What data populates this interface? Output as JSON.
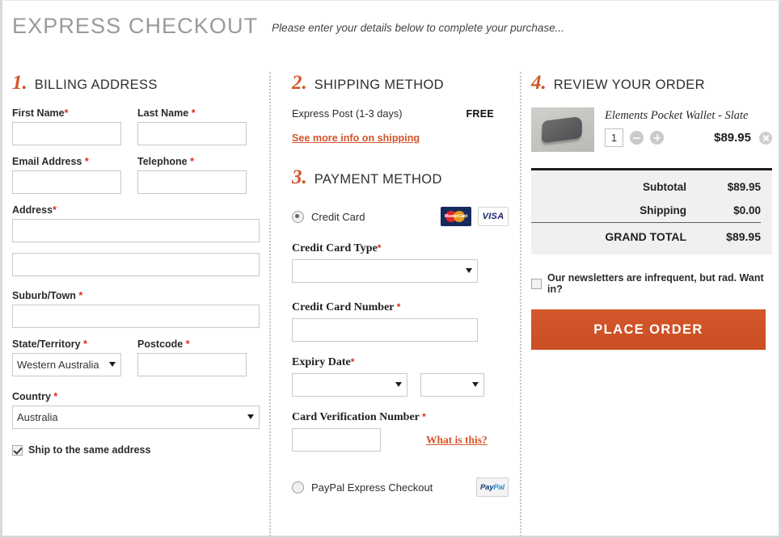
{
  "header": {
    "title": "EXPRESS CHECKOUT",
    "subtitle": "Please enter your details below to complete your purchase..."
  },
  "billing": {
    "number": "1.",
    "title": "BILLING ADDRESS",
    "fields": {
      "first_name": {
        "label": "First Name",
        "required": "*",
        "value": ""
      },
      "last_name": {
        "label": "Last Name",
        "required": "*",
        "value": ""
      },
      "email": {
        "label": "Email Address",
        "required": "*",
        "value": ""
      },
      "telephone": {
        "label": "Telephone",
        "required": "*",
        "value": ""
      },
      "address": {
        "label": "Address",
        "required": "*",
        "value": ""
      },
      "address2": {
        "value": ""
      },
      "suburb": {
        "label": "Suburb/Town",
        "required": "*",
        "value": ""
      },
      "state": {
        "label": "State/Territory",
        "required": "*",
        "value": "Western Australia"
      },
      "postcode": {
        "label": "Postcode",
        "required": "*",
        "value": ""
      },
      "country": {
        "label": "Country",
        "required": "*",
        "value": "Australia"
      }
    },
    "ship_same": {
      "label": "Ship to the same address",
      "checked": true
    }
  },
  "shipping": {
    "number": "2.",
    "title": "SHIPPING METHOD",
    "option_label": "Express Post (1-3 days)",
    "option_price": "FREE",
    "more_info_link": "See more info on shipping"
  },
  "payment": {
    "number": "3.",
    "title": "PAYMENT METHOD",
    "credit_card_option": "Credit Card",
    "credit_card_selected": true,
    "card_logos": [
      "MasterCard",
      "VISA"
    ],
    "fields": {
      "card_type": {
        "label": "Credit Card Type",
        "required": "*",
        "value": ""
      },
      "card_number": {
        "label": "Credit Card Number",
        "required": "*",
        "value": ""
      },
      "expiry": {
        "label": "Expiry Date",
        "required": "*",
        "month": "",
        "year": ""
      },
      "cvn": {
        "label": "Card Verification Number",
        "required": "*",
        "value": ""
      }
    },
    "what_is_this_link": "What is this?",
    "paypal_option": "PayPal Express Checkout",
    "paypal_selected": false,
    "paypal_logo": {
      "part1": "Pay",
      "part2": "Pal"
    }
  },
  "review": {
    "number": "4.",
    "title": "REVIEW YOUR ORDER",
    "item": {
      "name": "Elements Pocket Wallet - Slate",
      "quantity": "1",
      "price": "$89.95"
    },
    "totals": [
      {
        "label": "Subtotal",
        "value": "$89.95"
      },
      {
        "label": "Shipping",
        "value": "$0.00"
      },
      {
        "label": "GRAND TOTAL",
        "value": "$89.95"
      }
    ],
    "newsletter": {
      "label": "Our newsletters are infrequent, but rad. Want in?",
      "checked": false
    },
    "place_order_button": "PLACE ORDER"
  },
  "colors": {
    "accent": "#d2552a",
    "button": "#cd5226",
    "required": "#e02b20",
    "totals_bg": "#f0f0f0"
  }
}
